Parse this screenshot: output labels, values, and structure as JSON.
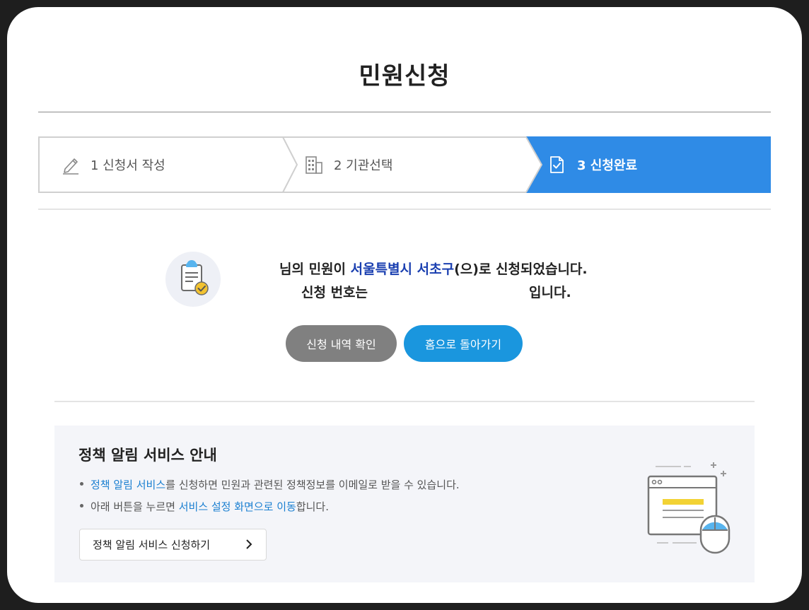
{
  "page": {
    "title": "민원신청"
  },
  "steps": [
    {
      "label": "1 신청서 작성",
      "icon": "pencil-icon"
    },
    {
      "label": "2 기관선택",
      "icon": "building-icon"
    },
    {
      "label": "3 신청완료",
      "icon": "document-check-icon"
    }
  ],
  "colors": {
    "active_step": "#2f8be6",
    "link": "#1a3fb0",
    "home_button": "#1a96de",
    "check_button": "#808080"
  },
  "complete": {
    "line1_a": "님의 민원이 ",
    "line1_org": "서울특별시 서초구",
    "line1_b": "(으)로 신청되었습니다.",
    "line2_a": "신청 번호는",
    "line2_b": "입니다.",
    "check_button": "신청 내역 확인",
    "home_button": "홈으로 돌아가기"
  },
  "info": {
    "title": "정책 알림 서비스 안내",
    "line1_link": "정책 알림 서비스",
    "line1_rest": "를 신청하면 민원과 관련된 정책정보를 이메일로 받을 수 있습니다.",
    "line2_pre": "아래 버튼을 누르면 ",
    "line2_link": "서비스 설정 화면으로 이동",
    "line2_post": "합니다.",
    "button": "정책 알림 서비스 신청하기"
  }
}
